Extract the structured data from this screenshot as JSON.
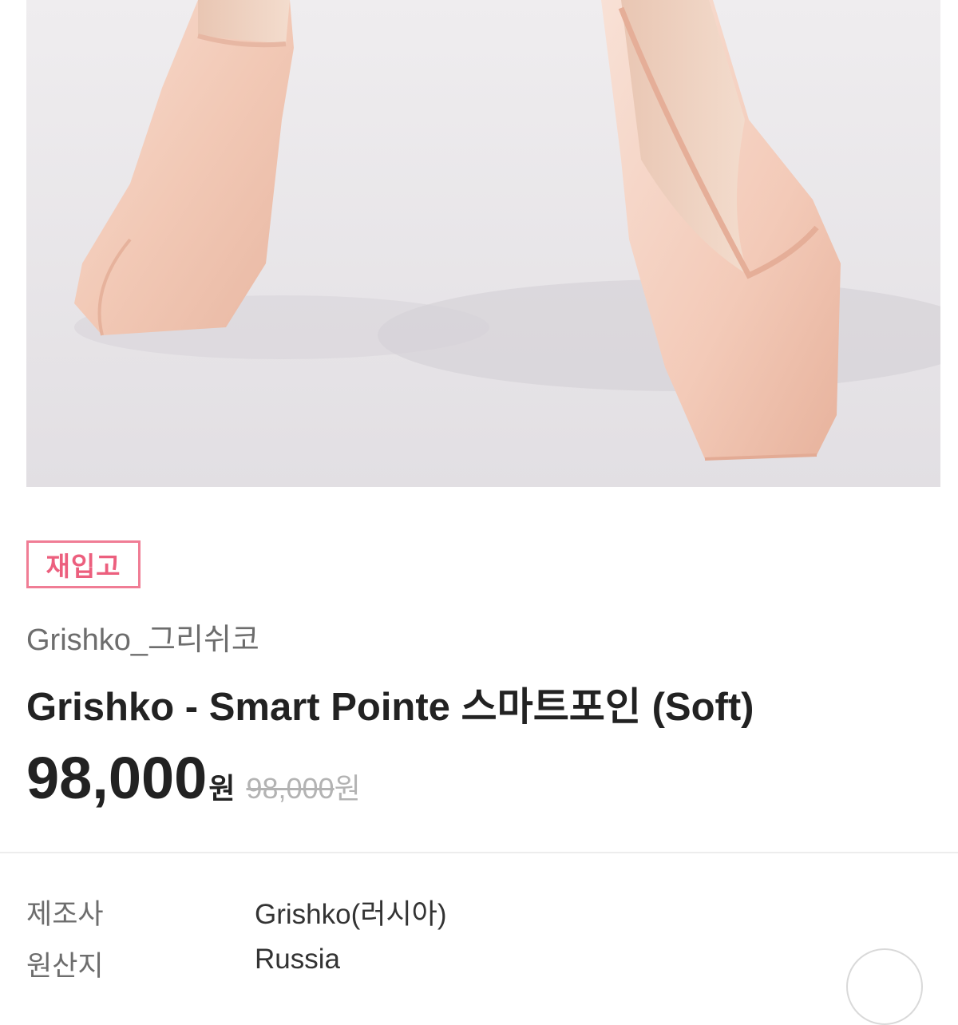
{
  "product": {
    "badge": "재입고",
    "brand": "Grishko_그리쉬코",
    "title": "Grishko - Smart Pointe 스마트포인 (Soft)",
    "price": "98,000",
    "price_unit": "원",
    "original_price": "98,000",
    "original_price_unit": "원"
  },
  "info": [
    {
      "label": "제조사",
      "value": "Grishko(러시아)"
    },
    {
      "label": "원산지",
      "value": "Russia"
    }
  ],
  "colors": {
    "accent": "#ec5f7e",
    "badge_border": "#f07d95",
    "image_background": "#e9e7ea",
    "satin": "#f3cdbd"
  },
  "icons": {
    "scroll_top": "scroll-top-icon"
  }
}
